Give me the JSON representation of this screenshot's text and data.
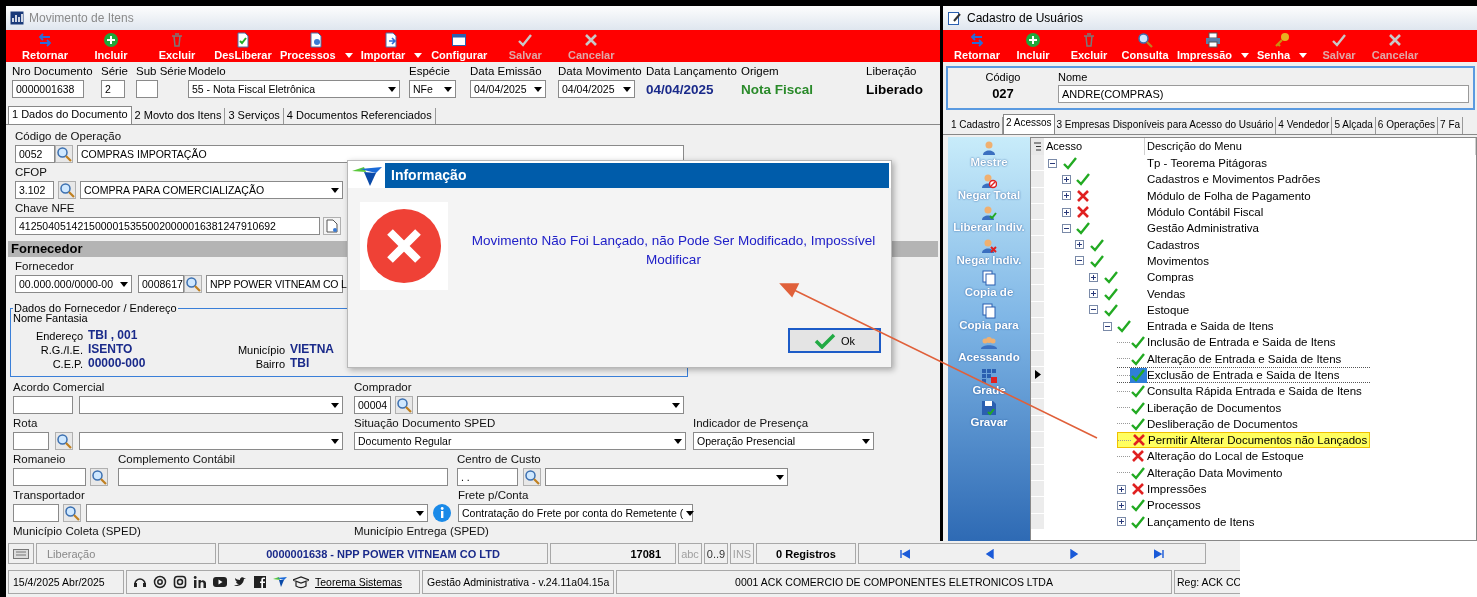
{
  "left_window": {
    "title": "Movimento de Itens",
    "toolbar": [
      {
        "label": "Retornar",
        "disabled": false,
        "dropdown": false
      },
      {
        "label": "Incluir",
        "disabled": false,
        "dropdown": false
      },
      {
        "label": "Excluir",
        "disabled": false,
        "dropdown": false
      },
      {
        "label": "DesLiberar",
        "disabled": false,
        "dropdown": false
      },
      {
        "label": "Processos",
        "disabled": false,
        "dropdown": true
      },
      {
        "label": "Importar",
        "disabled": false,
        "dropdown": true
      },
      {
        "label": "Configurar",
        "disabled": false,
        "dropdown": false
      },
      {
        "label": "Salvar",
        "disabled": true,
        "dropdown": false
      },
      {
        "label": "Cancelar",
        "disabled": true,
        "dropdown": false
      }
    ],
    "header_fields": [
      {
        "label": "Nro Documento",
        "value": "0000001638",
        "kind": "input"
      },
      {
        "label": "Série",
        "value": "2",
        "kind": "input"
      },
      {
        "label": "Sub Série",
        "kind": "input"
      },
      {
        "label": "Modelo",
        "value": "55 - Nota Fiscal Eletrônica",
        "kind": "select"
      },
      {
        "label": "Espécie",
        "value": "NFe",
        "kind": "select"
      },
      {
        "label": "Data Emissão",
        "value": "04/04/2025",
        "kind": "select"
      },
      {
        "label": "Data Movimento",
        "value": "04/04/2025",
        "kind": "select"
      },
      {
        "label": "Data Lançamento",
        "value": "04/04/2025",
        "kind": "display",
        "color": "#1a2a8a"
      },
      {
        "label": "Origem",
        "value": "Nota Fiscal",
        "kind": "display",
        "color": "#2a8a2a"
      },
      {
        "label": "Liberação",
        "value": "Liberado",
        "kind": "display",
        "color": "#000000"
      }
    ],
    "tabs": [
      {
        "label": "1 Dados do Documento",
        "selected": true
      },
      {
        "label": "2 Movto dos Itens",
        "selected": false
      },
      {
        "label": "3 Serviços",
        "selected": false
      },
      {
        "label": "4 Documentos Referenciados",
        "selected": false
      }
    ],
    "form": {
      "operacao": {
        "label": "Código de Operação",
        "code": "0052",
        "description": "COMPRAS IMPORTAÇÃO"
      },
      "cfop": {
        "label": "CFOP",
        "code": "3.102",
        "description": "COMPRA PARA COMERCIALIZAÇÃO"
      },
      "chave_nfe": {
        "label": "Chave NFE",
        "value": "41250405142150000153550020000016381247910692"
      },
      "section_title": "Fornecedor",
      "fornecedor": {
        "label": "Fornecedor",
        "document": "00.000.000/0000-00",
        "code": "0008617",
        "name": "NPP POWER VITNEAM CO L"
      },
      "address_group": {
        "title": "Dados do Fornecedor / Endereço",
        "trade_name_label": "Nome Fantasia",
        "fields": [
          {
            "label": "Endereço",
            "value": "TBI , 001"
          },
          {
            "label": "R.G./I.E.",
            "value": "ISENTO"
          },
          {
            "label": "Município",
            "value": "VIETNA"
          },
          {
            "label": "C.E.P.",
            "value": "00000-000"
          },
          {
            "label": "Bairro",
            "value": "TBI"
          }
        ]
      },
      "acordo_comercial": {
        "label": "Acordo Comercial"
      },
      "comprador": {
        "label": "Comprador",
        "code": "00004"
      },
      "rota": {
        "label": "Rota"
      },
      "situacao_sped": {
        "label": "Situação Documento SPED",
        "value": "Documento Regular"
      },
      "indicador_presenca": {
        "label": "Indicador de Presença",
        "value": "Operação Presencial"
      },
      "romaneio": {
        "label": "Romaneio"
      },
      "complemento_contabil": {
        "label": "Complemento Contábil"
      },
      "centro_custo": {
        "label": "Centro de Custo",
        "value": ".  ."
      },
      "transportador": {
        "label": "Transportador"
      },
      "frete": {
        "label": "Frete p/Conta",
        "value": "Contratação do Frete por conta do Remetente ("
      },
      "municipio_coleta": {
        "label": "Município Coleta (SPED)"
      },
      "municipio_entrega": {
        "label": "Município Entrega (SPED)"
      }
    }
  },
  "dialog": {
    "title": "Informação",
    "message": "Movimento Não Foi Lançado, não Pode Ser Modificado, Impossível Modificar",
    "button": "Ok"
  },
  "right_window": {
    "title": "Cadastro de Usuários",
    "toolbar": [
      {
        "label": "Retornar",
        "disabled": false,
        "dropdown": false
      },
      {
        "label": "Incluir",
        "disabled": false,
        "dropdown": false
      },
      {
        "label": "Excluir",
        "disabled": false,
        "dropdown": false
      },
      {
        "label": "Consulta",
        "disabled": false,
        "dropdown": false
      },
      {
        "label": "Impressão",
        "disabled": false,
        "dropdown": true
      },
      {
        "label": "Senha",
        "disabled": false,
        "dropdown": true
      },
      {
        "label": "Salvar",
        "disabled": true,
        "dropdown": false
      },
      {
        "label": "Cancelar",
        "disabled": true,
        "dropdown": false
      }
    ],
    "code": {
      "label": "Código",
      "value": "027"
    },
    "name": {
      "label": "Nome",
      "value": "ANDRE(COMPRAS)"
    },
    "tabs": [
      {
        "label": "1 Cadastro",
        "selected": false
      },
      {
        "label": "2 Acessos",
        "selected": true
      },
      {
        "label": "3 Empresas Disponíveis para Acesso do Usuário",
        "selected": false
      },
      {
        "label": "4 Vendedor",
        "selected": false
      },
      {
        "label": "5 Alçada",
        "selected": false
      },
      {
        "label": "6 Operações",
        "selected": false
      },
      {
        "label": "7 Fa",
        "selected": false
      }
    ],
    "side_buttons": [
      {
        "label": "Mestre"
      },
      {
        "label": "Negar Total"
      },
      {
        "label": "Liberar Indiv."
      },
      {
        "label": "Negar Indiv."
      },
      {
        "label": "Copia de"
      },
      {
        "label": "Copia para"
      },
      {
        "label": "Acessando"
      },
      {
        "label": "Grade"
      },
      {
        "label": "Gravar"
      }
    ],
    "tree": {
      "columns": [
        "Acesso",
        "Descrição do Menu"
      ],
      "items": [
        {
          "label": "Tp - Teorema Pitágoras",
          "allowed": true,
          "expanded": true,
          "selected": false,
          "highlighted": false,
          "children": [
            {
              "label": "Cadastros e Movimentos Padrões",
              "allowed": true,
              "expanded": false,
              "selected": false,
              "highlighted": false
            },
            {
              "label": "Módulo de Folha de Pagamento",
              "allowed": false,
              "expanded": false,
              "selected": false,
              "highlighted": false
            },
            {
              "label": "Módulo Contábil Fiscal",
              "allowed": false,
              "expanded": false,
              "selected": false,
              "highlighted": false
            },
            {
              "label": "Gestão Administrativa",
              "allowed": true,
              "expanded": true,
              "selected": false,
              "highlighted": false,
              "children": [
                {
                  "label": "Cadastros",
                  "allowed": true,
                  "expanded": false,
                  "selected": false,
                  "highlighted": false
                },
                {
                  "label": "Movimentos",
                  "allowed": true,
                  "expanded": true,
                  "selected": false,
                  "highlighted": false,
                  "children": [
                    {
                      "label": "Compras",
                      "allowed": true,
                      "expanded": false,
                      "selected": false,
                      "highlighted": false
                    },
                    {
                      "label": "Vendas",
                      "allowed": true,
                      "expanded": false,
                      "selected": false,
                      "highlighted": false
                    },
                    {
                      "label": "Estoque",
                      "allowed": true,
                      "expanded": true,
                      "selected": false,
                      "highlighted": false,
                      "children": [
                        {
                          "label": "Entrada e Saida de Itens",
                          "allowed": true,
                          "expanded": true,
                          "selected": false,
                          "highlighted": false,
                          "children": [
                            {
                              "label": "Inclusão de Entrada e Saida de Itens",
                              "allowed": true,
                              "selected": false,
                              "highlighted": false
                            },
                            {
                              "label": "Alteração de Entrada e Saida de Itens",
                              "allowed": true,
                              "selected": false,
                              "highlighted": false
                            },
                            {
                              "label": "Exclusão de Entrada e Saida de Itens",
                              "allowed": true,
                              "selected": true,
                              "highlighted": false
                            },
                            {
                              "label": "Consulta Rápida Entrada e Saida de Itens",
                              "allowed": true,
                              "selected": false,
                              "highlighted": false
                            },
                            {
                              "label": "Liberação de Documentos",
                              "allowed": true,
                              "selected": false,
                              "highlighted": false
                            },
                            {
                              "label": "Desliberação de Documentos",
                              "allowed": true,
                              "selected": false,
                              "highlighted": false
                            },
                            {
                              "label": "Permitir Alterar Documentos não Lançados",
                              "allowed": false,
                              "selected": false,
                              "highlighted": true
                            },
                            {
                              "label": "Alteração do Local de Estoque",
                              "allowed": false,
                              "selected": false,
                              "highlighted": false
                            },
                            {
                              "label": "Alteração Data Movimento",
                              "allowed": true,
                              "selected": false,
                              "highlighted": false
                            },
                            {
                              "label": "Impressões",
                              "allowed": false,
                              "expanded": false,
                              "selected": false,
                              "highlighted": false
                            },
                            {
                              "label": "Processos",
                              "allowed": true,
                              "expanded": false,
                              "selected": false,
                              "highlighted": false
                            },
                            {
                              "label": "Lançamento de Itens",
                              "allowed": true,
                              "expanded": false,
                              "selected": false,
                              "highlighted": false
                            }
                          ]
                        }
                      ]
                    }
                  ]
                }
              ]
            }
          ]
        }
      ]
    }
  },
  "status_bar": {
    "label": "Liberação",
    "record": "0000001638 - NPP POWER VITNEAM CO LTD",
    "number": "17081",
    "indicators": [
      {
        "label": "abc",
        "on": false
      },
      {
        "label": "0..9",
        "on": true
      },
      {
        "label": "INS",
        "on": false
      }
    ],
    "records": "0 Registros"
  },
  "footer": {
    "date": "15/4/2025 Abr/2025",
    "company_link": "Teorema Sistemas",
    "module": "Gestão Administrativa - v.24.11a04.15a",
    "company": "0001 ACK COMERCIO DE COMPONENTES ELETRONICOS LTDA",
    "registration": "Reg: ACK CO"
  }
}
